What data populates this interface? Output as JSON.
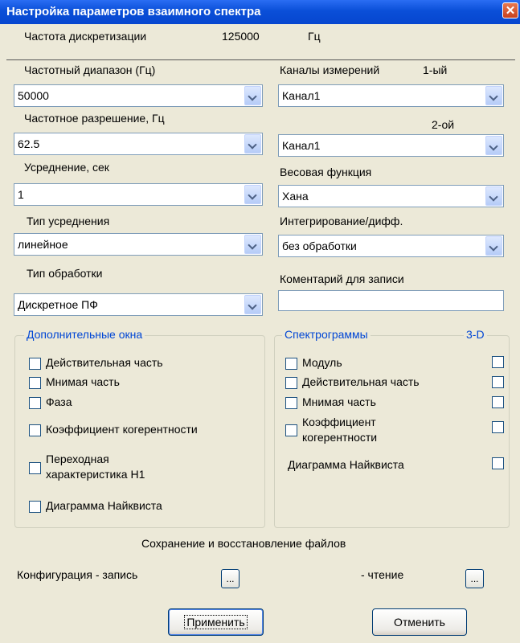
{
  "window": {
    "title": "Настройка параметров взаимного спектра",
    "close_icon": "✕"
  },
  "sampling": {
    "label": "Частота дискретизации",
    "value": "125000",
    "unit": "Гц"
  },
  "left": {
    "freq_range": {
      "label": "Частотный диапазон (Гц)",
      "value": "50000"
    },
    "freq_resolution": {
      "label": "Частотное разрешение, Гц",
      "value": "62.5"
    },
    "averaging": {
      "label": "Усреднение, сек",
      "value": "1"
    },
    "averaging_type": {
      "label": "Тип усреднения",
      "value": "линейное"
    },
    "processing_type": {
      "label": "Тип обработки",
      "value": "Дискретное ПФ"
    }
  },
  "right": {
    "channels_label": "Каналы измерений",
    "first_label": "1-ый",
    "channel1_value": "Канал1",
    "second_label": "2-ой",
    "channel2_value": "Канал1",
    "weight": {
      "label": "Весовая функция",
      "value": "Хана"
    },
    "integration": {
      "label": "Интегрирование/дифф.",
      "value": "без обработки"
    },
    "comment": {
      "label": "Коментарий для записи",
      "value": ""
    }
  },
  "extra_windows": {
    "title": "Дополнительные окна",
    "items": [
      {
        "label": "Действительная часть",
        "checked": false
      },
      {
        "label": "Мнимая часть",
        "checked": false
      },
      {
        "label": "Фаза",
        "checked": false
      },
      {
        "label": "Коэффициент когерентности",
        "checked": false
      },
      {
        "label_line1": "Переходная",
        "label_line2": "характеристика Н1",
        "checked": false
      },
      {
        "label": "Диаграмма Найквиста",
        "checked": false
      }
    ]
  },
  "spectrograms": {
    "title": "Спектрограммы",
    "title_3d": "3-D",
    "items": [
      {
        "label": "Модуль",
        "checked": false
      },
      {
        "label": "Действительная часть",
        "checked": false
      },
      {
        "label": "Мнимая часть",
        "checked": false
      },
      {
        "label_line1": "Коэффициент",
        "label_line2": "когерентности",
        "checked": false
      }
    ],
    "nyquist_label": "Диаграмма Найквиста"
  },
  "files": {
    "title": "Сохранение и восстановление файлов",
    "config_write_label": "Конфигурация - запись",
    "read_label": "- чтение",
    "browse_label": "..."
  },
  "buttons": {
    "apply": "Применить",
    "cancel": "Отменить"
  }
}
